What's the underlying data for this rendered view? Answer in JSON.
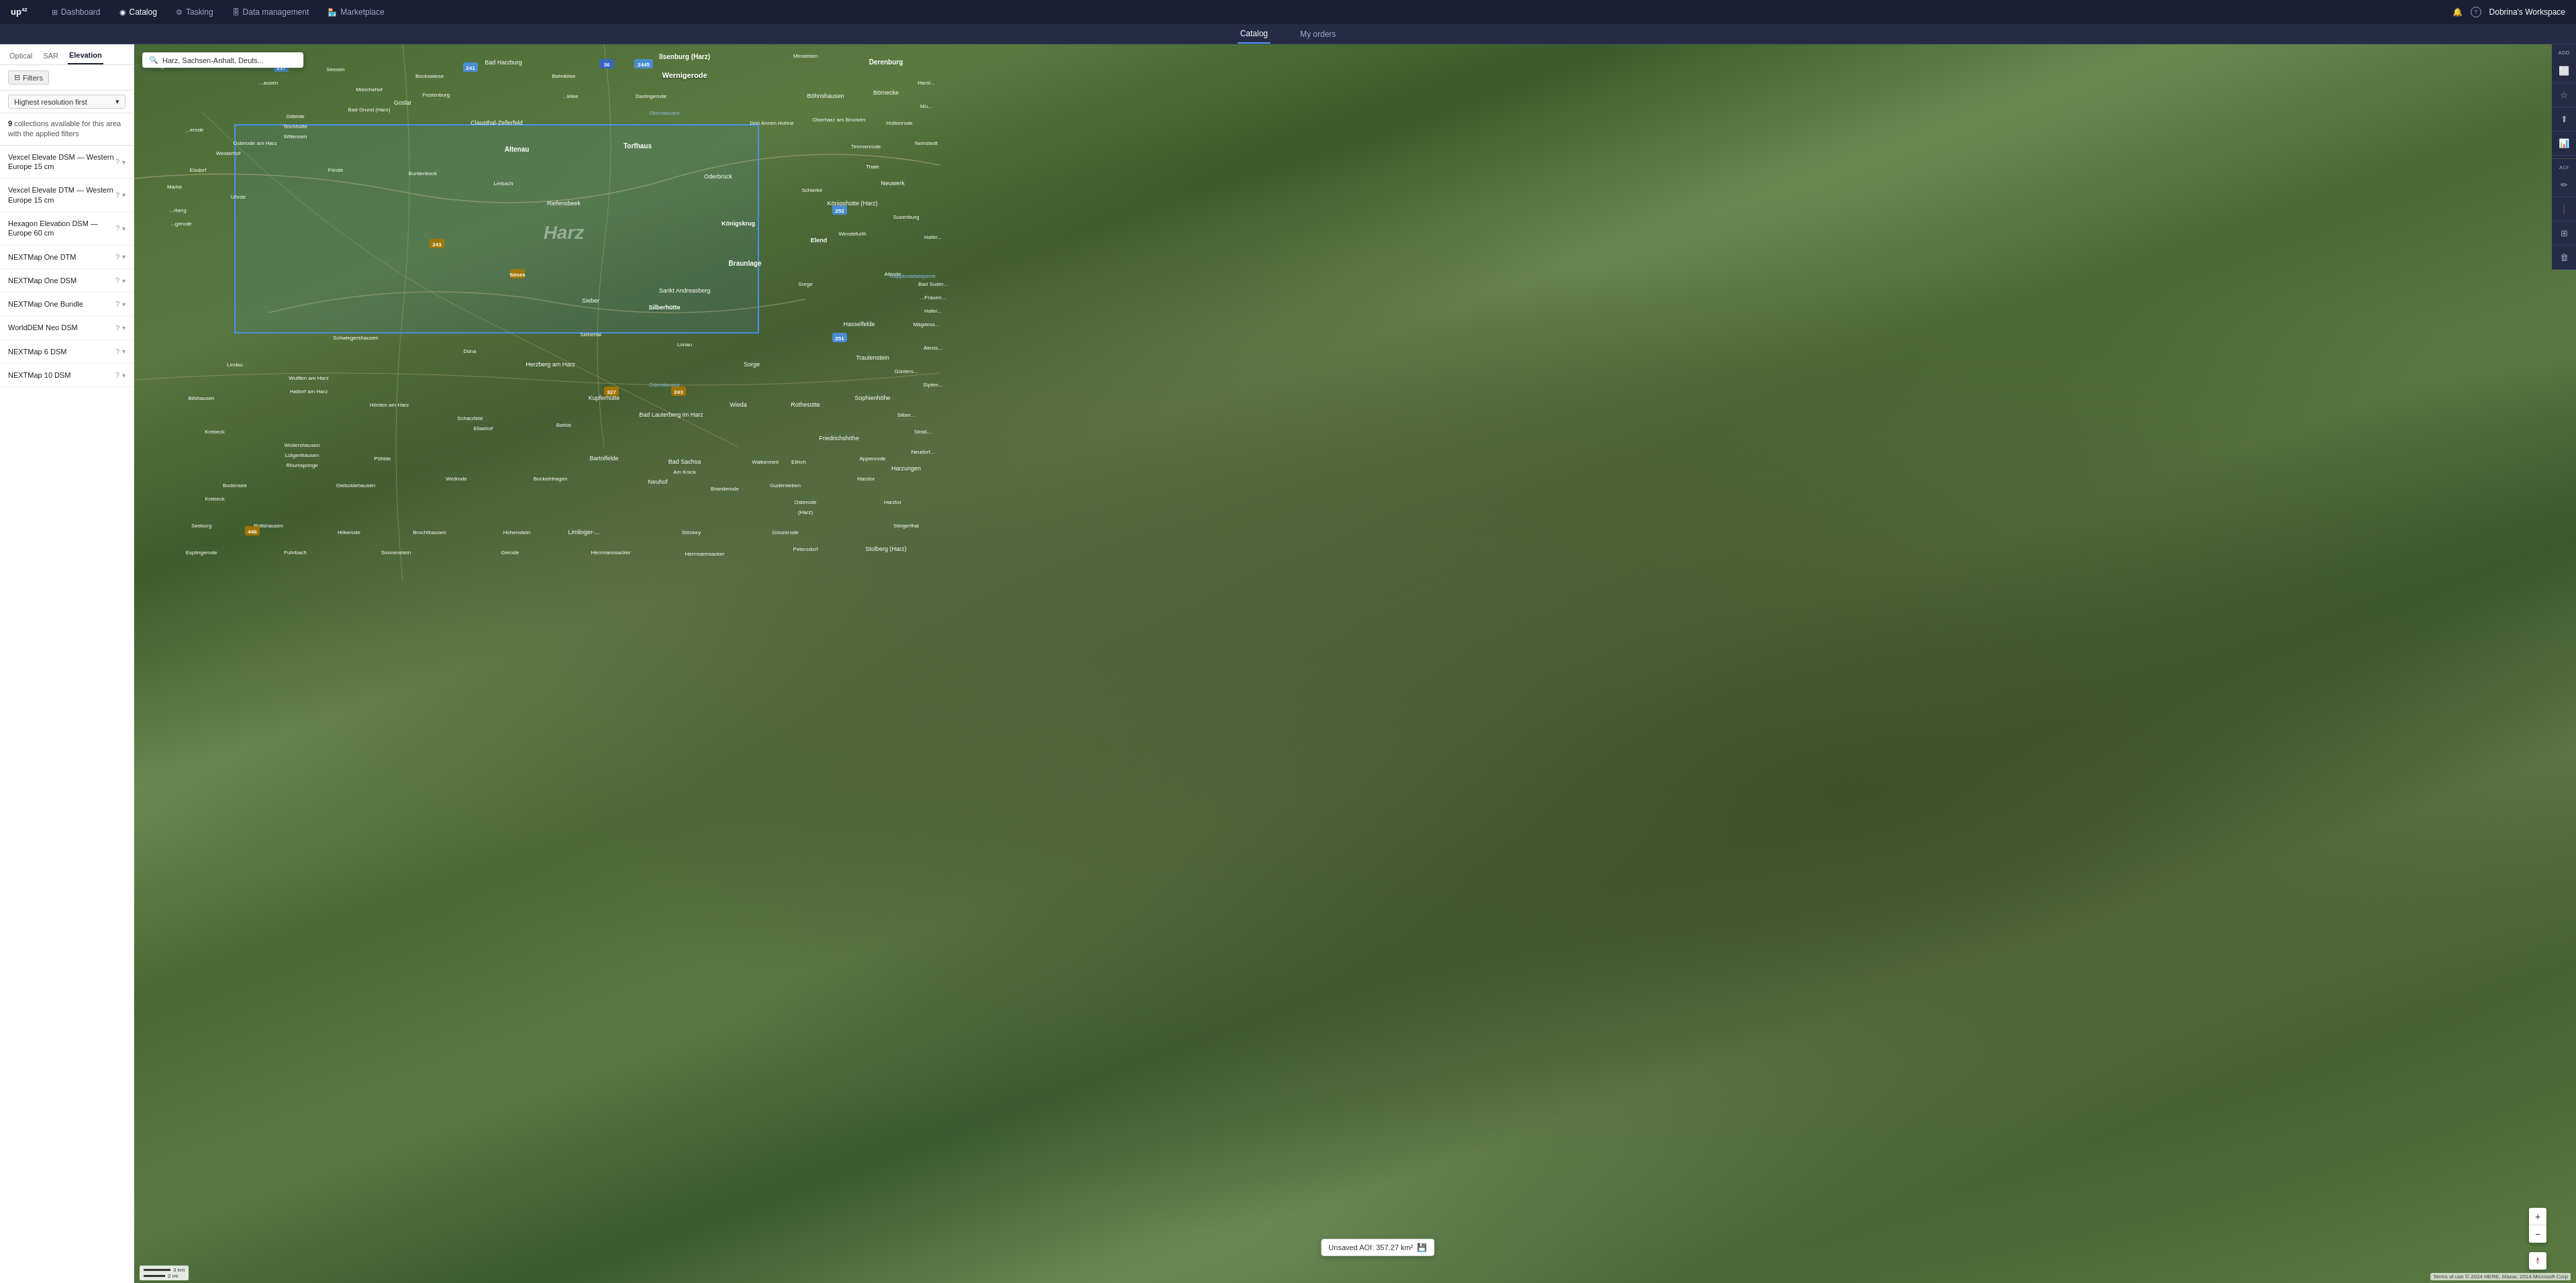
{
  "app": {
    "logo": "up42"
  },
  "top_nav": {
    "items": [
      {
        "id": "dashboard",
        "label": "Dashboard",
        "icon": "⊞",
        "active": false
      },
      {
        "id": "catalog",
        "label": "Catalog",
        "icon": "◉",
        "active": true
      },
      {
        "id": "tasking",
        "label": "Tasking",
        "icon": "⚙",
        "active": false
      },
      {
        "id": "data-management",
        "label": "Data management",
        "icon": "🗄",
        "active": false
      },
      {
        "id": "marketplace",
        "label": "Marketplace",
        "icon": "🏪",
        "active": false
      }
    ],
    "right": {
      "notification_icon": "🔔",
      "help_icon": "?",
      "workspace": "Dobrina's Workspace"
    }
  },
  "sub_nav": {
    "items": [
      {
        "id": "catalog",
        "label": "Catalog",
        "active": true
      },
      {
        "id": "my-orders",
        "label": "My orders",
        "active": false
      }
    ]
  },
  "sidebar": {
    "type_tabs": [
      {
        "id": "optical",
        "label": "Optical",
        "active": false
      },
      {
        "id": "sar",
        "label": "SAR",
        "active": false
      },
      {
        "id": "elevation",
        "label": "Elevation",
        "active": true
      }
    ],
    "filters_btn": "Filters",
    "filters_icon": "⊟",
    "sort": {
      "label": "Highest resolution first",
      "chevron": "▾"
    },
    "collections_info": {
      "count": "9",
      "count_label": "collections available",
      "suffix": "for this area with the applied filters"
    },
    "collections": [
      {
        "id": "vexcel-dsm",
        "name": "Vexcel Elevate DSM — Western Europe 15 cm"
      },
      {
        "id": "vexcel-dtm",
        "name": "Vexcel Elevate DTM — Western Europe 15 cm"
      },
      {
        "id": "hexagon-dsm",
        "name": "Hexagon Elevation DSM — Europe 60 cm"
      },
      {
        "id": "nextmap-dtm",
        "name": "NEXTMap One DTM"
      },
      {
        "id": "nextmap-dsm",
        "name": "NEXTMap One DSM"
      },
      {
        "id": "nextmap-bundle",
        "name": "NEXTMap One Bundle"
      },
      {
        "id": "worlddem-neo",
        "name": "WorldDEM Neo DSM"
      },
      {
        "id": "nextmap-6",
        "name": "NEXTMap 6 DSM"
      },
      {
        "id": "nextmap-10",
        "name": "NEXTMap 10 DSM"
      }
    ]
  },
  "map": {
    "search_placeholder": "Harz, Sachsen-Anhalt, Deuts...",
    "attribution": "Terms of use  © 2024 HERE, Maxar, 2014 Microsoft Corp",
    "scale_labels": [
      "3 km",
      "2 mi"
    ],
    "aoi_tooltip": "Unsaved AOI: 357.27 km²"
  },
  "right_toolbar": {
    "sections": [
      {
        "label": "ADD",
        "buttons": [
          {
            "id": "add-rect",
            "icon": "⬜",
            "label": ""
          },
          {
            "id": "add-star",
            "icon": "☆",
            "label": ""
          },
          {
            "id": "add-upload",
            "icon": "⬆",
            "label": ""
          },
          {
            "id": "add-chart",
            "icon": "📊",
            "label": ""
          }
        ]
      },
      {
        "label": "AOI",
        "buttons": [
          {
            "id": "aoi-edit",
            "icon": "✏",
            "label": ""
          },
          {
            "id": "aoi-pipe",
            "icon": "|",
            "label": ""
          },
          {
            "id": "aoi-table",
            "icon": "⊞",
            "label": ""
          },
          {
            "id": "aoi-delete",
            "icon": "🗑",
            "label": ""
          }
        ]
      }
    ]
  },
  "zoom_controls": {
    "plus": "+",
    "minus": "−",
    "compass": "⊕"
  }
}
